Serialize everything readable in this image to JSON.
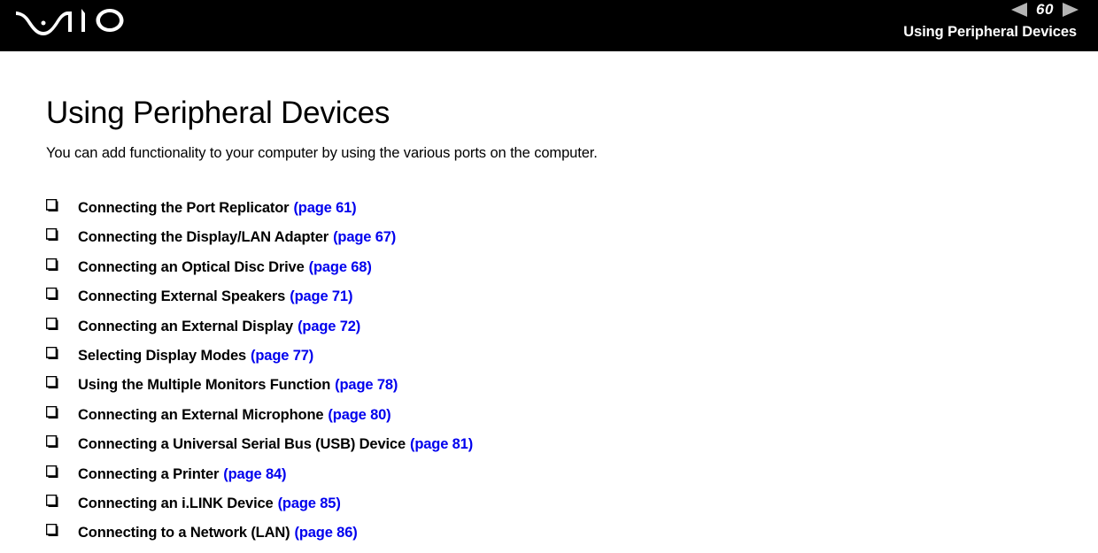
{
  "header": {
    "logo": "vaio-logo",
    "page_number": "60",
    "prev_icon": "triangle-left-icon",
    "next_icon": "triangle-right-icon",
    "title": "Using Peripheral Devices",
    "background_color": "#000000",
    "arrow_color": "#b4b4b4"
  },
  "main": {
    "title": "Using Peripheral Devices",
    "intro": "You can add functionality to your computer by using the various ports on the computer.",
    "bullet_icon": "shadowed-square-bullet-icon",
    "link_color": "#0000ee",
    "items": [
      {
        "label": "Connecting the Port Replicator",
        "page": "(page 61)"
      },
      {
        "label": "Connecting the Display/LAN Adapter",
        "page": "(page 67)"
      },
      {
        "label": "Connecting an Optical Disc Drive",
        "page": "(page 68)"
      },
      {
        "label": "Connecting External Speakers",
        "page": "(page 71)"
      },
      {
        "label": "Connecting an External Display",
        "page": "(page 72)"
      },
      {
        "label": "Selecting Display Modes",
        "page": "(page 77)"
      },
      {
        "label": "Using the Multiple Monitors Function",
        "page": "(page 78)"
      },
      {
        "label": "Connecting an External Microphone",
        "page": "(page 80)"
      },
      {
        "label": "Connecting a Universal Serial Bus (USB) Device",
        "page": "(page 81)"
      },
      {
        "label": "Connecting a Printer",
        "page": "(page 84)"
      },
      {
        "label": "Connecting an i.LINK Device",
        "page": "(page 85)"
      },
      {
        "label": "Connecting to a Network (LAN)",
        "page": "(page 86)"
      }
    ]
  }
}
